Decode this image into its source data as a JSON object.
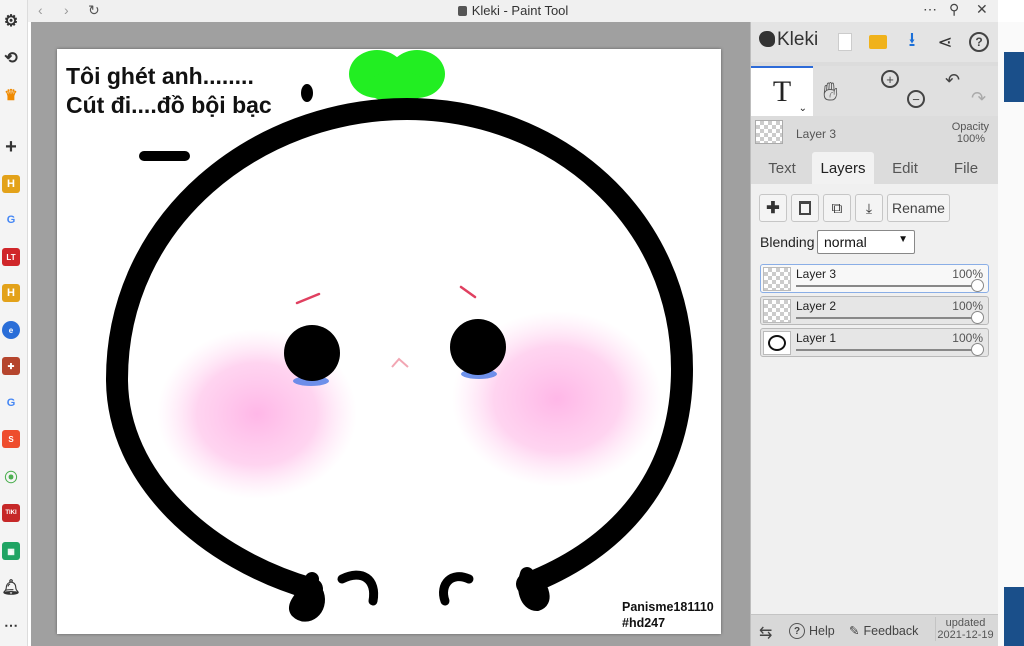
{
  "window": {
    "title": "Kleki - Paint Tool"
  },
  "drawing": {
    "caption_line1": "Tôi ghét anh........",
    "caption_line2": "Cút đi....đồ bội bạc",
    "signature_line1": "Panisme181110",
    "signature_line2": "#hd247"
  },
  "panel": {
    "logo": "Kleki",
    "active_tool": "T",
    "current_layer_name": "Layer 3",
    "opacity_label": "Opacity",
    "opacity_value": "100%",
    "tabs": [
      {
        "label": "Text"
      },
      {
        "label": "Layers"
      },
      {
        "label": "Edit"
      },
      {
        "label": "File"
      }
    ],
    "active_tab": "Layers",
    "rename_label": "Rename",
    "blending_label": "Blending",
    "blending_value": "normal",
    "layers": [
      {
        "name": "Layer 3",
        "opacity": "100%",
        "selected": true
      },
      {
        "name": "Layer 2",
        "opacity": "100%",
        "selected": false
      },
      {
        "name": "Layer 1",
        "opacity": "100%",
        "selected": false
      }
    ],
    "bottom": {
      "help": "Help",
      "feedback": "Feedback",
      "updated_label": "updated",
      "updated_date": "2021-12-19"
    }
  },
  "colors": {
    "accent": "#2d6bd8",
    "sprout": "#22ee22",
    "blush": "#ffb3e6",
    "canvas_bg": "#a0a0a0"
  }
}
